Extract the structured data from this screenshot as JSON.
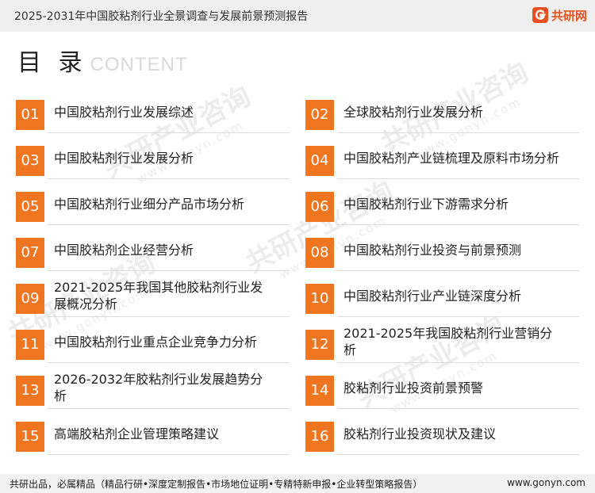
{
  "header": {
    "title": "2025-2031年中国胶粘剂行业全景调查与发展前景预测报告",
    "brand_name": "共研网",
    "brand_icon": "gonyn-logo-icon",
    "background": "#efefef"
  },
  "toc": {
    "title": "目 录",
    "subtitle": "CONTENT",
    "accent_color": "#f07521",
    "items": [
      {
        "num": "01",
        "label": "中国胶粘剂行业发展综述"
      },
      {
        "num": "02",
        "label": "全球胶粘剂行业发展分析"
      },
      {
        "num": "03",
        "label": "中国胶粘剂行业发展分析"
      },
      {
        "num": "04",
        "label": "中国胶粘剂产业链梳理及原料市场分析"
      },
      {
        "num": "05",
        "label": "中国胶粘剂行业细分产品市场分析"
      },
      {
        "num": "06",
        "label": "中国胶粘剂行业下游需求分析"
      },
      {
        "num": "07",
        "label": "中国胶粘剂企业经营分析"
      },
      {
        "num": "08",
        "label": "中国胶粘剂行业投资与前景预测"
      },
      {
        "num": "09",
        "label": "2021-2025年我国其他胶粘剂行业发展概况分析"
      },
      {
        "num": "10",
        "label": "中国胶粘剂行业产业链深度分析"
      },
      {
        "num": "11",
        "label": "中国胶粘剂行业重点企业竞争力分析"
      },
      {
        "num": "12",
        "label": "2021-2025年我国胶粘剂行业营销分析"
      },
      {
        "num": "13",
        "label": "2026-2032年胶粘剂行业发展趋势分析"
      },
      {
        "num": "14",
        "label": "胶粘剂行业投资前景预警"
      },
      {
        "num": "15",
        "label": "高端胶粘剂企业管理策略建议"
      },
      {
        "num": "16",
        "label": "胶粘剂行业投资现状及建议"
      }
    ]
  },
  "watermark": {
    "text": "共研产业咨询",
    "url": "www.gonyn.com"
  },
  "footer": {
    "left": "共研出品，必属精品（精品行研•深度定制报告•市场地位证明•专精特新申报•企业转型策略报告）",
    "right": "www.gonyn.com"
  }
}
